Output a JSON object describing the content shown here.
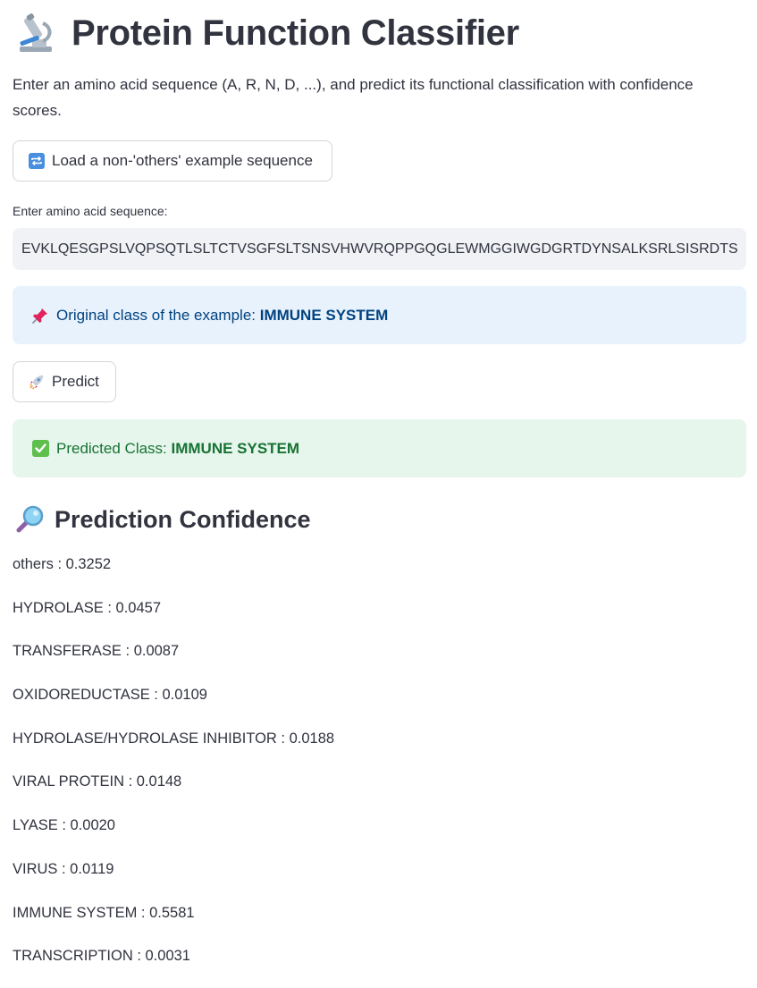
{
  "header": {
    "title": "Protein Function Classifier",
    "icon": "microscope-icon"
  },
  "intro_text": "Enter an amino acid sequence (A, R, N, D, ...), and predict its functional classification with confidence scores.",
  "load_button": {
    "label": "Load a non-'others' example sequence",
    "icon": "repeat-icon"
  },
  "sequence_input": {
    "label": "Enter amino acid sequence:",
    "value": "EVKLQESGPSLVQPSQTLSLTCTVSGFSLTSNSVHWVRQPPGQGLEWMGGIWGDGRTDYNSALKSRLSISRDTSKSQVFLKMNSLQTDDTAMYYCARDRYGYFDYWGQGTTLTVSS"
  },
  "original_class": {
    "prefix": "Original class of the example: ",
    "value": "IMMUNE SYSTEM",
    "icon": "pushpin-icon"
  },
  "predict_button": {
    "label": "Predict",
    "icon": "rocket-icon"
  },
  "predicted": {
    "prefix": "Predicted Class: ",
    "value": "IMMUNE SYSTEM",
    "icon": "check-box-icon"
  },
  "confidence": {
    "title": "Prediction Confidence",
    "icon": "magnifier-icon",
    "items": [
      {
        "label": "others : 0.3252"
      },
      {
        "label": "HYDROLASE : 0.0457"
      },
      {
        "label": "TRANSFERASE : 0.0087"
      },
      {
        "label": "OXIDOREDUCTASE : 0.0109"
      },
      {
        "label": "HYDROLASE/HYDROLASE INHIBITOR : 0.0188"
      },
      {
        "label": "VIRAL PROTEIN : 0.0148"
      },
      {
        "label": "LYASE : 0.0020"
      },
      {
        "label": "VIRUS : 0.0119"
      },
      {
        "label": "IMMUNE SYSTEM : 0.5581"
      },
      {
        "label": "TRANSCRIPTION : 0.0031"
      }
    ]
  },
  "colors": {
    "info_bg": "#e8f2fc",
    "info_text": "#004280",
    "success_bg": "#e6f6ec",
    "success_text": "#177233",
    "input_bg": "#f0f2f6",
    "text": "#31333f"
  }
}
